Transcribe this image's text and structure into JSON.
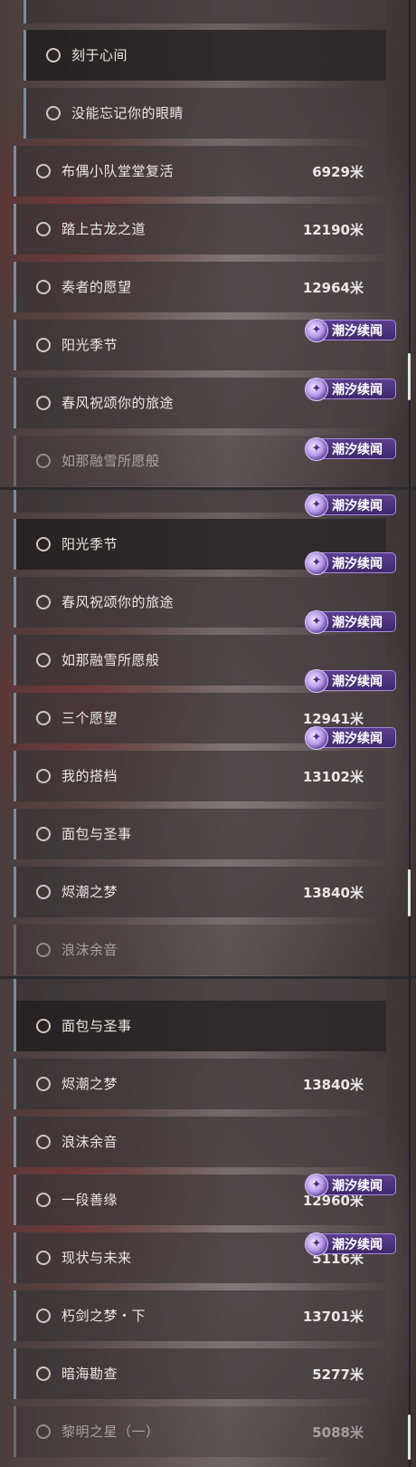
{
  "tag_label": "潮汐续闻",
  "panels": [
    {
      "rows": [
        {
          "title": "刻于心间",
          "dist": ""
        },
        {
          "title": "没能忘记你的眼睛",
          "dist": ""
        },
        {
          "title": "布偶小队堂堂复活",
          "dist": "6929米"
        },
        {
          "title": "踏上古龙之道",
          "dist": "12190米"
        },
        {
          "title": "奏者的愿望",
          "dist": "12964米"
        },
        {
          "title": "阳光季节",
          "dist": ""
        },
        {
          "title": "春风祝颂你的旅途",
          "dist": ""
        },
        {
          "title": "如那融雪所愿般",
          "dist": ""
        }
      ]
    },
    {
      "rows": [
        {
          "title": "阳光季节",
          "dist": ""
        },
        {
          "title": "春风祝颂你的旅途",
          "dist": ""
        },
        {
          "title": "如那融雪所愿般",
          "dist": ""
        },
        {
          "title": "三个愿望",
          "dist": "12941米"
        },
        {
          "title": "我的搭档",
          "dist": "13102米"
        },
        {
          "title": "面包与圣事",
          "dist": ""
        },
        {
          "title": "烬潮之梦",
          "dist": "13840米"
        },
        {
          "title": "浪沫余音",
          "dist": ""
        }
      ]
    },
    {
      "rows": [
        {
          "title": "面包与圣事",
          "dist": ""
        },
        {
          "title": "烬潮之梦",
          "dist": "13840米"
        },
        {
          "title": "浪沫余音",
          "dist": ""
        },
        {
          "title": "一段善缘",
          "dist": "12960米"
        },
        {
          "title": "现状与未来",
          "dist": "5116米"
        },
        {
          "title": "朽剑之梦・下",
          "dist": "13701米"
        },
        {
          "title": "暗海勘查",
          "dist": "5277米"
        },
        {
          "title": "黎明之星（一）",
          "dist": "5088米"
        }
      ]
    }
  ]
}
